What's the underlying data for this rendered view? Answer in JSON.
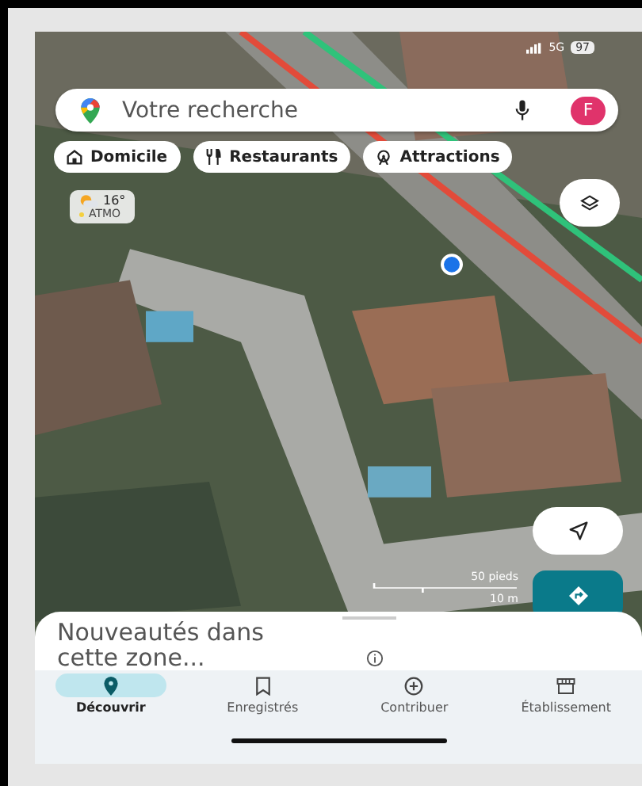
{
  "status_bar": {
    "network": "5G",
    "battery": "97"
  },
  "search": {
    "placeholder": "Votre recherche",
    "avatar": "F"
  },
  "chips": [
    {
      "label": "Domicile",
      "kind": "home"
    },
    {
      "label": "Restaurants",
      "kind": "food"
    },
    {
      "label": "Attractions",
      "kind": "attraction"
    }
  ],
  "weather": {
    "temperature": "16°",
    "air_quality": "ATMO"
  },
  "scale": {
    "imperial": "50 pieds",
    "metric": "10 m"
  },
  "sheet": {
    "title": "Nouveautés dans cette zone..."
  },
  "nav": [
    {
      "label": "Découvrir",
      "kind": "explore",
      "selected": true
    },
    {
      "label": "Enregistrés",
      "kind": "saved",
      "selected": false
    },
    {
      "label": "Contribuer",
      "kind": "contribute",
      "selected": false
    },
    {
      "label": "Établissement",
      "kind": "business",
      "selected": false
    }
  ]
}
